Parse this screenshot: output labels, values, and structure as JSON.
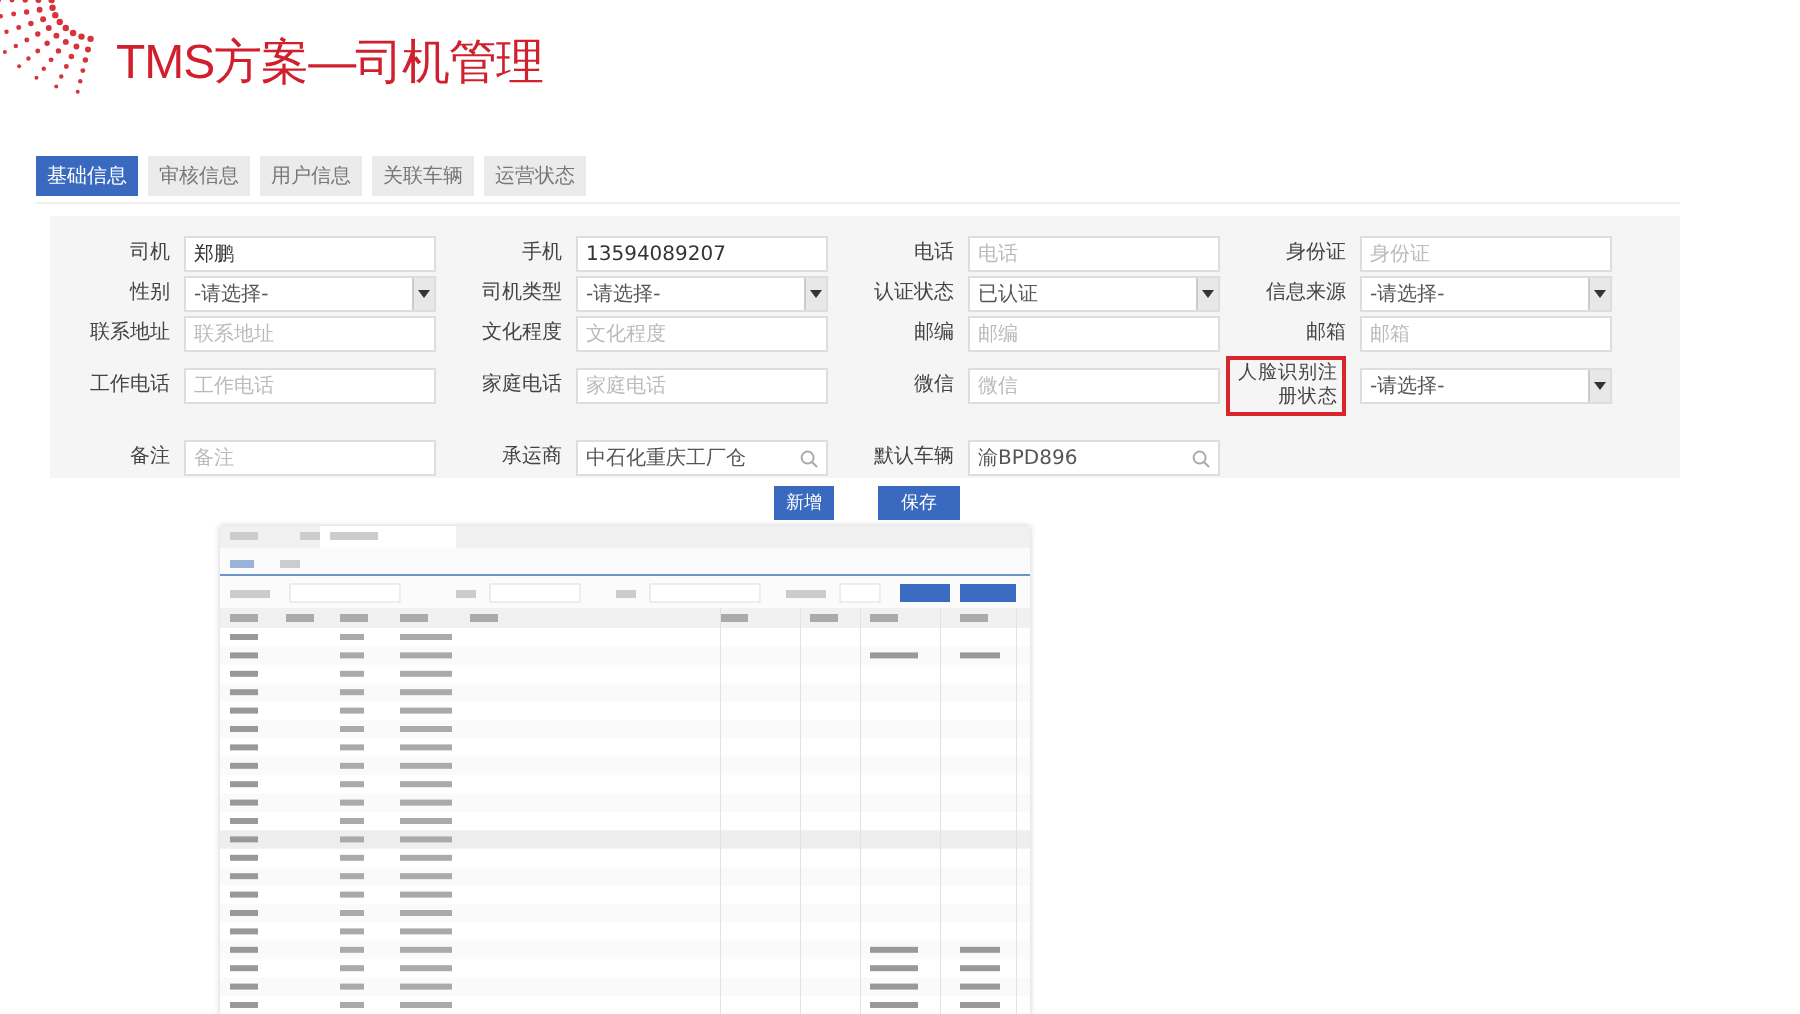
{
  "title": "TMS方案—司机管理",
  "tabs": [
    {
      "label": "基础信息",
      "selected": true
    },
    {
      "label": "审核信息",
      "selected": false
    },
    {
      "label": "用户信息",
      "selected": false
    },
    {
      "label": "关联车辆",
      "selected": false
    },
    {
      "label": "运营状态",
      "selected": false
    }
  ],
  "form": {
    "rows": [
      [
        {
          "label": "司机",
          "kind": "text",
          "value": "郑鹏"
        },
        {
          "label": "手机",
          "kind": "text",
          "value": "13594089207"
        },
        {
          "label": "电话",
          "kind": "text",
          "placeholder": "电话"
        },
        {
          "label": "身份证",
          "kind": "text",
          "placeholder": "身份证"
        }
      ],
      [
        {
          "label": "性别",
          "kind": "select",
          "value": "-请选择-"
        },
        {
          "label": "司机类型",
          "kind": "select",
          "value": "-请选择-"
        },
        {
          "label": "认证状态",
          "kind": "select",
          "value": "已认证"
        },
        {
          "label": "信息来源",
          "kind": "select",
          "value": "-请选择-"
        }
      ],
      [
        {
          "label": "联系地址",
          "kind": "text",
          "placeholder": "联系地址"
        },
        {
          "label": "文化程度",
          "kind": "text",
          "placeholder": "文化程度"
        },
        {
          "label": "邮编",
          "kind": "text",
          "placeholder": "邮编"
        },
        {
          "label": "邮箱",
          "kind": "text",
          "placeholder": "邮箱"
        }
      ],
      [
        {
          "label": "工作电话",
          "kind": "text",
          "placeholder": "工作电话"
        },
        {
          "label": "家庭电话",
          "kind": "text",
          "placeholder": "家庭电话"
        },
        {
          "label": "微信",
          "kind": "text",
          "placeholder": "微信"
        },
        {
          "label": "人脸识别注册状态",
          "kind": "select",
          "value": "-请选择-",
          "highlighted": true
        }
      ],
      [
        {
          "label": "备注",
          "kind": "text",
          "placeholder": "备注"
        },
        {
          "label": "承运商",
          "kind": "search",
          "value": "中石化重庆工厂仓"
        },
        {
          "label": "默认车辆",
          "kind": "search",
          "value": "渝BPD896"
        }
      ]
    ]
  },
  "buttons": [
    "新增",
    "保存"
  ]
}
